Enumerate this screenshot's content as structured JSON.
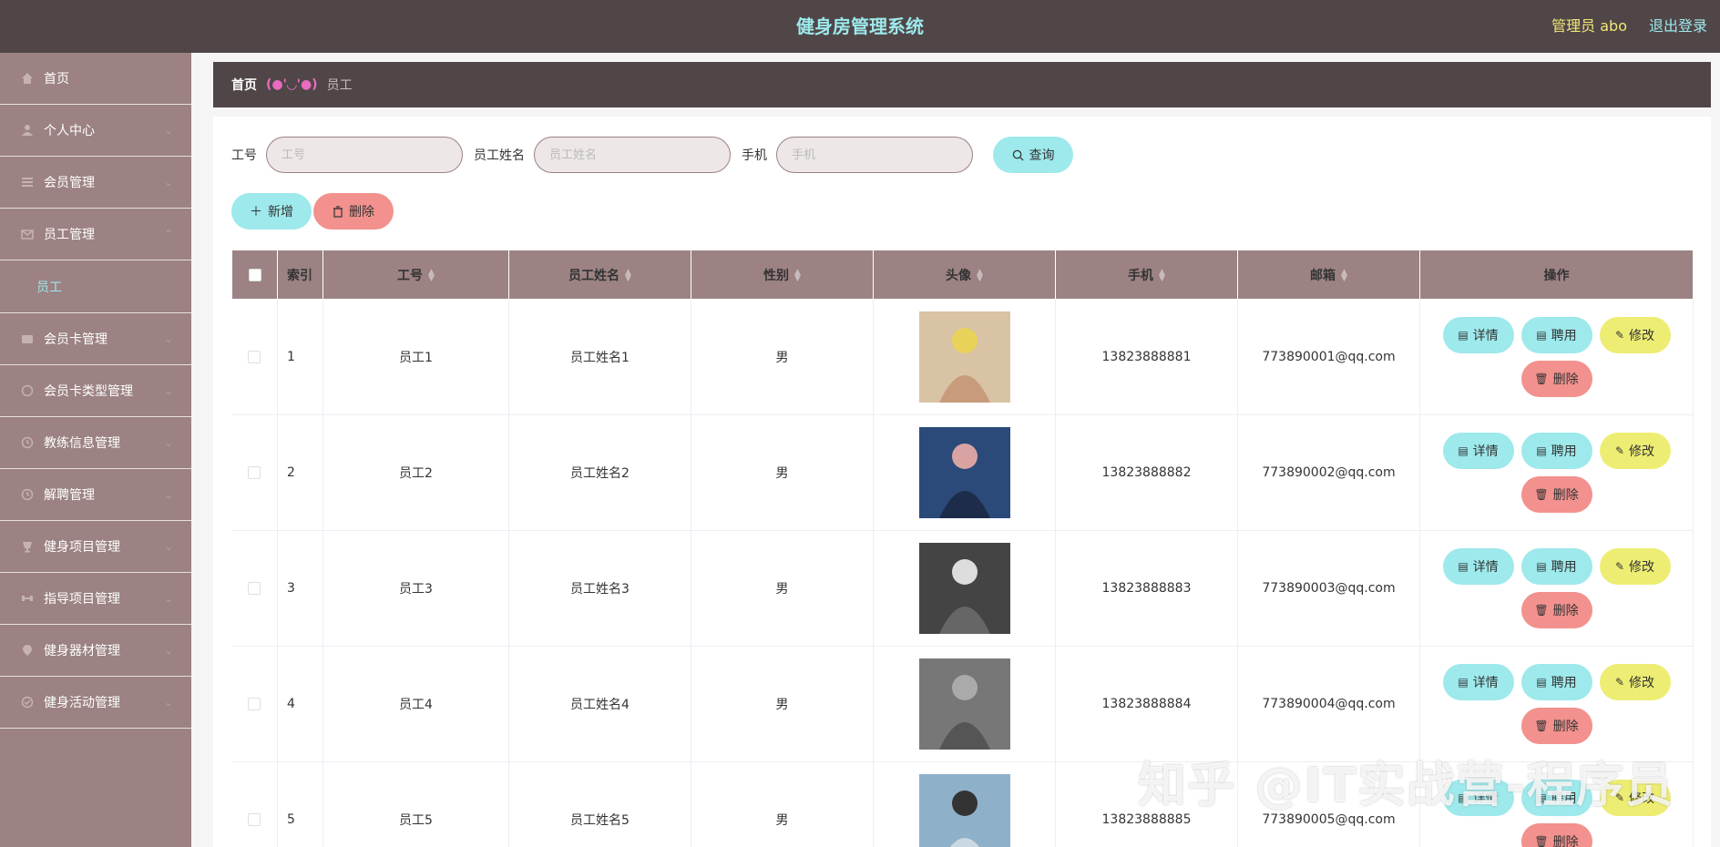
{
  "header": {
    "title": "健身房管理系统",
    "admin": "管理员 abo",
    "logout": "退出登录"
  },
  "sidebar": {
    "items": [
      {
        "label": "首页",
        "icon": "home-icon"
      },
      {
        "label": "个人中心",
        "icon": "user-icon"
      },
      {
        "label": "会员管理",
        "icon": "list-icon"
      },
      {
        "label": "员工管理",
        "icon": "mail-icon",
        "sub": "员工"
      },
      {
        "label": "会员卡管理",
        "icon": "card-icon"
      },
      {
        "label": "会员卡类型管理",
        "icon": "circle-icon"
      },
      {
        "label": "教练信息管理",
        "icon": "clock-icon"
      },
      {
        "label": "解聘管理",
        "icon": "clock-icon"
      },
      {
        "label": "健身项目管理",
        "icon": "cup-icon"
      },
      {
        "label": "指导项目管理",
        "icon": "dumbbell-icon"
      },
      {
        "label": "健身器材管理",
        "icon": "location-icon"
      },
      {
        "label": "健身活动管理",
        "icon": "check-circle-icon"
      }
    ]
  },
  "breadcrumb": {
    "home": "首页",
    "sep": "(●'◡'●)",
    "current": "员工"
  },
  "search": {
    "id_label": "工号",
    "id_placeholder": "工号",
    "name_label": "员工姓名",
    "name_placeholder": "员工姓名",
    "phone_label": "手机",
    "phone_placeholder": "手机",
    "query": "查询"
  },
  "actions": {
    "add": "新增",
    "delete": "删除"
  },
  "table": {
    "headers": {
      "index": "索引",
      "id": "工号",
      "name": "员工姓名",
      "gender": "性别",
      "avatar": "头像",
      "phone": "手机",
      "email": "邮箱",
      "ops": "操作"
    },
    "ops": {
      "detail": "详情",
      "hire": "聘用",
      "edit": "修改",
      "delete": "删除"
    },
    "rows": [
      {
        "index": "1",
        "id": "员工1",
        "name": "员工姓名1",
        "gender": "男",
        "phone": "13823888881",
        "email": "773890001@qq.com"
      },
      {
        "index": "2",
        "id": "员工2",
        "name": "员工姓名2",
        "gender": "男",
        "phone": "13823888882",
        "email": "773890002@qq.com"
      },
      {
        "index": "3",
        "id": "员工3",
        "name": "员工姓名3",
        "gender": "男",
        "phone": "13823888883",
        "email": "773890003@qq.com"
      },
      {
        "index": "4",
        "id": "员工4",
        "name": "员工姓名4",
        "gender": "男",
        "phone": "13823888884",
        "email": "773890004@qq.com"
      },
      {
        "index": "5",
        "id": "员工5",
        "name": "员工姓名5",
        "gender": "男",
        "phone": "13823888885",
        "email": "773890005@qq.com"
      }
    ]
  },
  "watermark": "知乎 @IT实战营-程序员",
  "colors": {
    "header_bg": "#504647",
    "sidebar_bg": "#9c8283",
    "accent_cyan": "#9de9ec",
    "accent_yellow": "#eded73",
    "accent_red": "#f2918d"
  }
}
